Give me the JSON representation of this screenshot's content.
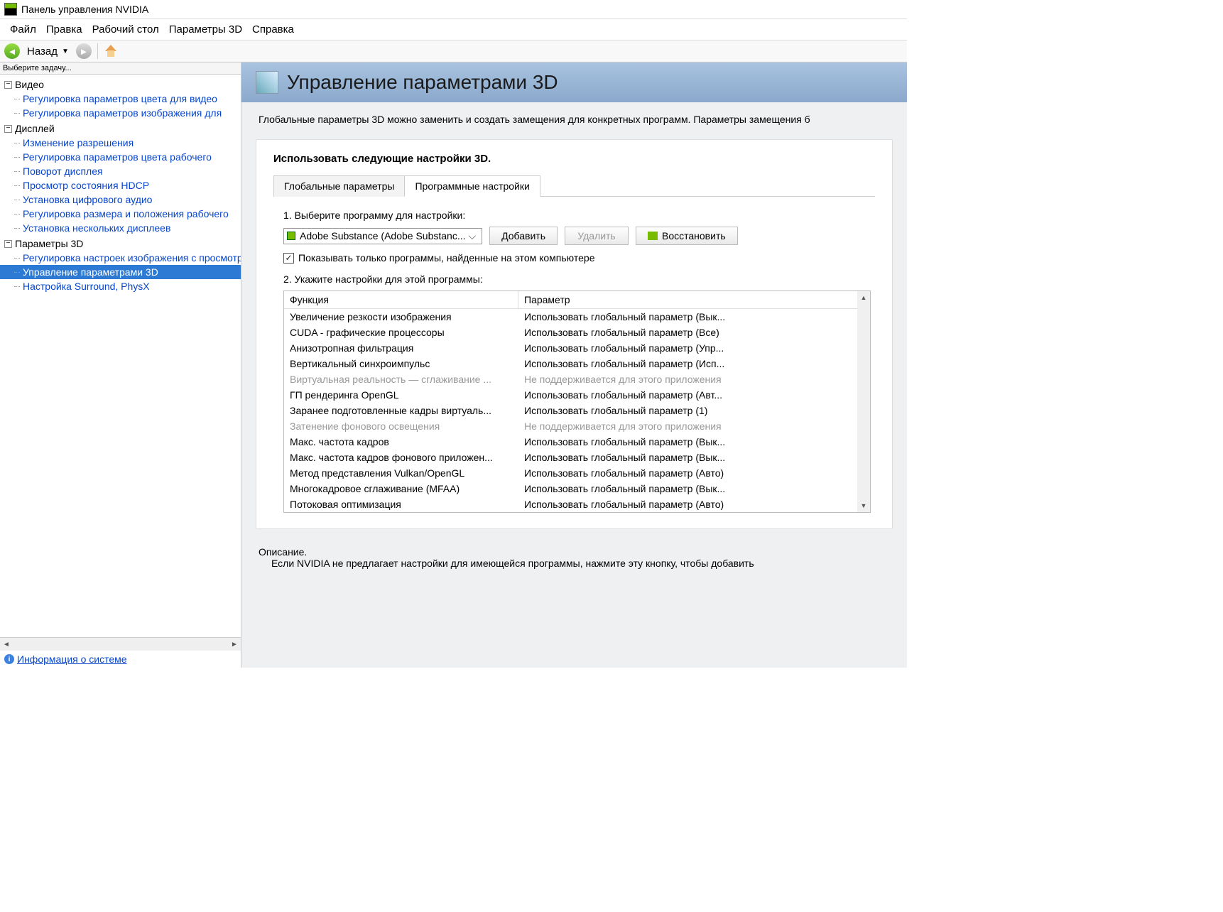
{
  "window": {
    "title": "Панель управления NVIDIA"
  },
  "menu": {
    "file": "Файл",
    "edit": "Правка",
    "desktop": "Рабочий стол",
    "params3d": "Параметры 3D",
    "help": "Справка"
  },
  "toolbar": {
    "back": "Назад"
  },
  "sidebar": {
    "task_header": "Выберите задачу...",
    "groups": [
      {
        "label": "Видео",
        "items": [
          "Регулировка параметров цвета для видео",
          "Регулировка параметров изображения для"
        ]
      },
      {
        "label": "Дисплей",
        "items": [
          "Изменение разрешения",
          "Регулировка параметров цвета рабочего",
          "Поворот дисплея",
          "Просмотр состояния HDCP",
          "Установка цифрового аудио",
          "Регулировка размера и положения рабочего",
          "Установка нескольких дисплеев"
        ]
      },
      {
        "label": "Параметры 3D",
        "items": [
          "Регулировка настроек изображения с просмотром",
          "Управление параметрами 3D",
          "Настройка Surround, PhysX"
        ],
        "selected": 1
      }
    ],
    "sysinfo": "Информация о системе"
  },
  "page": {
    "title": "Управление параметрами 3D",
    "description": "Глобальные параметры 3D можно заменить и создать замещения для конкретных программ. Параметры замещения б",
    "panel_title": "Использовать следующие настройки 3D.",
    "tabs": {
      "global": "Глобальные параметры",
      "program": "Программные настройки"
    },
    "step1": "1. Выберите программу для настройки:",
    "program_select": "Adobe Substance (Adobe Substanc...",
    "add_btn": "Добавить",
    "remove_btn": "Удалить",
    "restore_btn": "Восстановить",
    "checkbox": "Показывать только программы, найденные на этом компьютере",
    "step2": "2. Укажите настройки для этой программы:",
    "col_func": "Функция",
    "col_param": "Параметр",
    "rows": [
      {
        "f": "Увеличение резкости изображения",
        "p": "Использовать глобальный параметр (Вык..."
      },
      {
        "f": "CUDA - графические процессоры",
        "p": "Использовать глобальный параметр (Все)"
      },
      {
        "f": "Анизотропная фильтрация",
        "p": "Использовать глобальный параметр (Упр..."
      },
      {
        "f": "Вертикальный синхроимпульс",
        "p": "Использовать глобальный параметр (Исп..."
      },
      {
        "f": "Виртуальная реальность — сглаживание ...",
        "p": "Не поддерживается для этого приложения",
        "d": true
      },
      {
        "f": "ГП рендеринга OpenGL",
        "p": "Использовать глобальный параметр (Авт..."
      },
      {
        "f": "Заранее подготовленные кадры виртуаль...",
        "p": "Использовать глобальный параметр (1)"
      },
      {
        "f": "Затенение фонового освещения",
        "p": "Не поддерживается для этого приложения",
        "d": true
      },
      {
        "f": "Макс. частота кадров",
        "p": "Использовать глобальный параметр (Вык..."
      },
      {
        "f": "Макс. частота кадров фонового приложен...",
        "p": "Использовать глобальный параметр (Вык..."
      },
      {
        "f": "Метод представления Vulkan/OpenGL",
        "p": "Использовать глобальный параметр (Авто)"
      },
      {
        "f": "Многокадровое сглаживание (MFAA)",
        "p": "Использовать глобальный параметр (Вык..."
      },
      {
        "f": "Потоковая оптимизация",
        "p": "Использовать глобальный параметр (Авто)"
      }
    ],
    "desc_label": "Описание.",
    "desc_text": "Если NVIDIA не предлагает настройки для имеющейся программы, нажмите эту кнопку, чтобы добавить"
  }
}
